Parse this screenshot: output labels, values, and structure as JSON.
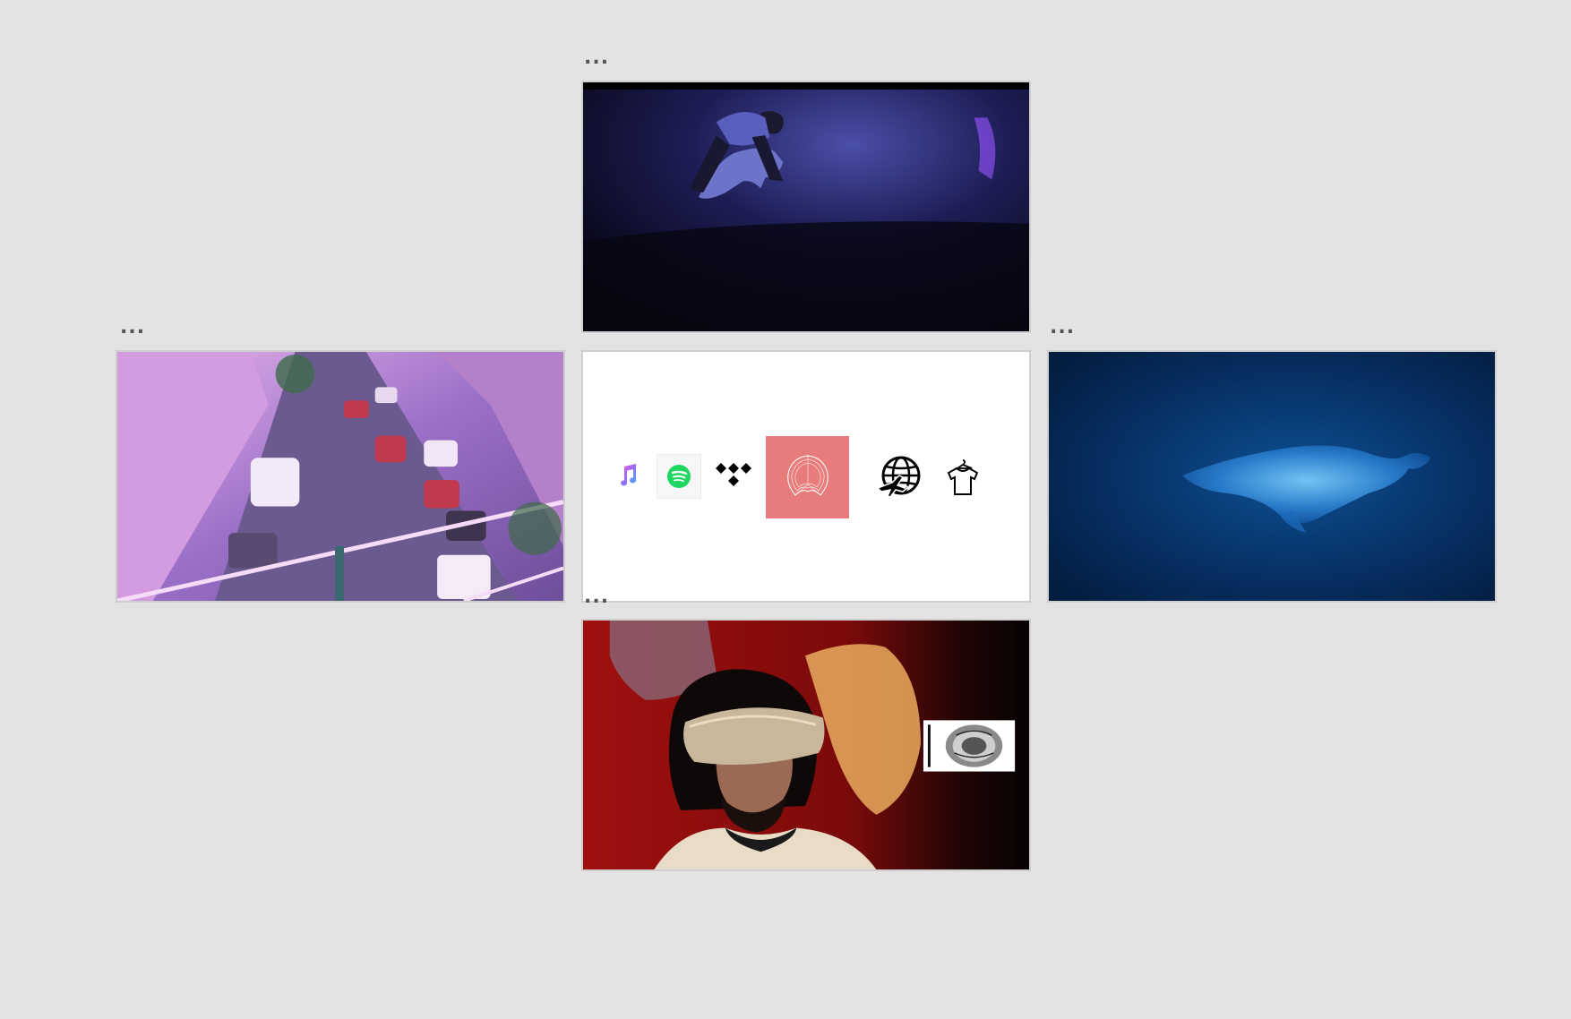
{
  "menu_glyph": "...",
  "tiles": {
    "top": {
      "kind": "video-thumbnail",
      "scene": "man-crawling-on-wet-ground-night"
    },
    "left": {
      "kind": "video-thumbnail",
      "scene": "aerial-city-street-purple"
    },
    "center": {
      "kind": "links-panel",
      "icons": [
        "apple-music-icon",
        "spotify-icon",
        "tidal-icon",
        "album-art",
        "travel-globe-icon",
        "merch-shirt-icon"
      ],
      "album_bg": "#e87b7b"
    },
    "right": {
      "kind": "video-thumbnail",
      "scene": "underwater-whale-blue"
    },
    "bottom": {
      "kind": "video-thumbnail",
      "scene": "man-in-vr-headset-red"
    }
  },
  "colors": {
    "background": "#e3e3e3",
    "spotify_green": "#1ed760",
    "album_coral": "#e87b7b"
  }
}
